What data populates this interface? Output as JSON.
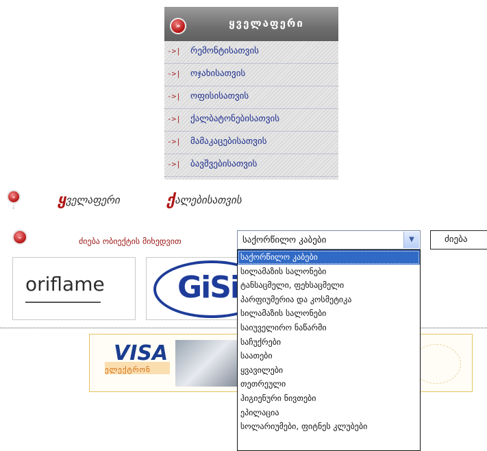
{
  "catmenu": {
    "title": "ყველაფერი",
    "items": [
      {
        "label": "რემონტისათვის"
      },
      {
        "label": "ოჯახისათვის"
      },
      {
        "label": "ოფისისათვის"
      },
      {
        "label": "ქალბატონებისათვის"
      },
      {
        "label": "მამაკაცებისათვის"
      },
      {
        "label": "ბავშვებისათვის"
      }
    ]
  },
  "breadcrumb": {
    "item1_first": "ყ",
    "item1_rest": "ველაფერი",
    "item2_first": "ქ",
    "item2_rest": "ალებისათვის"
  },
  "search": {
    "label": "ძიება ობიექტის მიხედვით",
    "selected": "საქორწილო კაბები",
    "button": "ძიება"
  },
  "brands": {
    "oriflame": "oriflame",
    "gisi": "GiSi"
  },
  "banner": {
    "visa": "VISA",
    "visa_sub": "ელექტრონ"
  },
  "dropdown": {
    "options": [
      {
        "label": "საქორწილო კაბები"
      },
      {
        "label": "სილამაზის სალონები"
      },
      {
        "label": "ტანსაცმელი, ფეხსაცმელი"
      },
      {
        "label": "პარფიუმერია და კოსმეტიკა"
      },
      {
        "label": "სილამაზის სალონები"
      },
      {
        "label": "საიუველირო ნაწარმი"
      },
      {
        "label": "საჩუქრები"
      },
      {
        "label": "საათები"
      },
      {
        "label": "ყვავილები"
      },
      {
        "label": "თეთრეული"
      },
      {
        "label": "ჰიგიენური ნივთები"
      },
      {
        "label": "ეპილაცია"
      },
      {
        "label": "სოლარიუმები, ფიტნეს კლუბები"
      }
    ]
  },
  "colors": {
    "accent": "#b01515",
    "link": "#1a2b8c",
    "selected": "#316ac5"
  }
}
